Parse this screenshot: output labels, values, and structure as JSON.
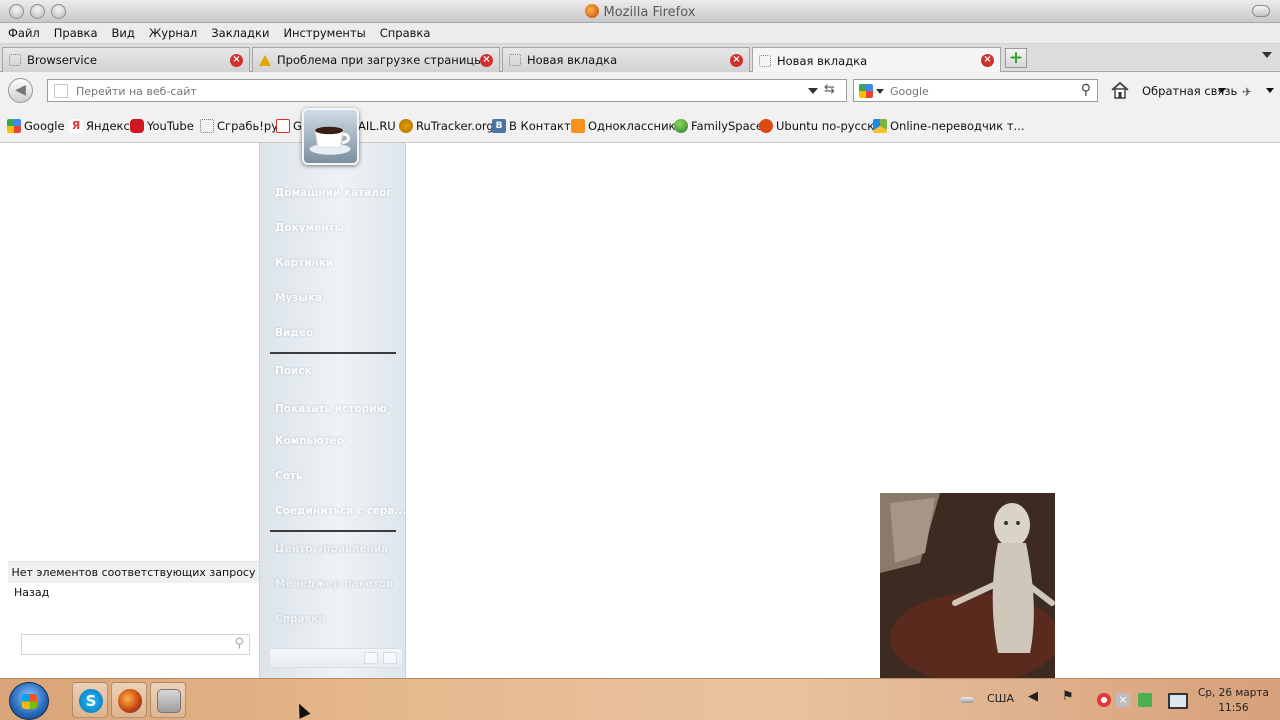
{
  "window": {
    "title": "Mozilla Firefox"
  },
  "menu": [
    "Файл",
    "Правка",
    "Вид",
    "Журнал",
    "Закладки",
    "Инструменты",
    "Справка"
  ],
  "tabs": [
    {
      "label": "Browservice",
      "icon": "blank-page-icon"
    },
    {
      "label": "Проблема при загрузке страницы",
      "icon": "warning-icon"
    },
    {
      "label": "Новая вкладка",
      "icon": "blank-page-icon"
    },
    {
      "label": "Новая вкладка",
      "icon": "blank-page-icon",
      "active": true
    }
  ],
  "nav": {
    "url_placeholder": "Перейти на веб-сайт",
    "search_placeholder": "Google",
    "feedback_label": "Обратная связь"
  },
  "bookmarks": [
    {
      "label": "Google",
      "color": "#4285f4"
    },
    {
      "label": "Яндекс",
      "color": "#e53935"
    },
    {
      "label": "YouTube",
      "color": "#cc181e"
    },
    {
      "label": "Cграбь!ру",
      "color": "#bdbdbd"
    },
    {
      "label": "Gr",
      "color": "#d93025"
    },
    {
      "label": "AIL.RU",
      "color": "#1565c0"
    },
    {
      "label": "RuTracker.org",
      "color": "#e0a100"
    },
    {
      "label": "В Контакте",
      "color": "#4c75a3"
    },
    {
      "label": "Одноклассники",
      "color": "#f7931e"
    },
    {
      "label": "FamilySpace",
      "color": "#43a047"
    },
    {
      "label": "Ubuntu по-русски",
      "color": "#dd4814"
    },
    {
      "label": "Online-переводчик т...",
      "color": "#7cb342"
    }
  ],
  "launcher": {
    "left": {
      "no_items": "Нет элементов соответствующих запросу",
      "back": "Назад"
    },
    "items": [
      "Домашний каталог",
      "Документы",
      "Картинки",
      "Музыка",
      "Видео",
      "Поиск",
      "Показать историю",
      "Компьютер",
      "Сеть",
      "Соединиться с серв...",
      "Центр управления",
      "Менеджер пакетов",
      "Справка"
    ]
  },
  "taskbar": {
    "lang": "США",
    "date": "Ср, 26 марта",
    "time": "11:56",
    "apps": [
      "skype-icon",
      "firefox-icon",
      "package-icon"
    ]
  }
}
